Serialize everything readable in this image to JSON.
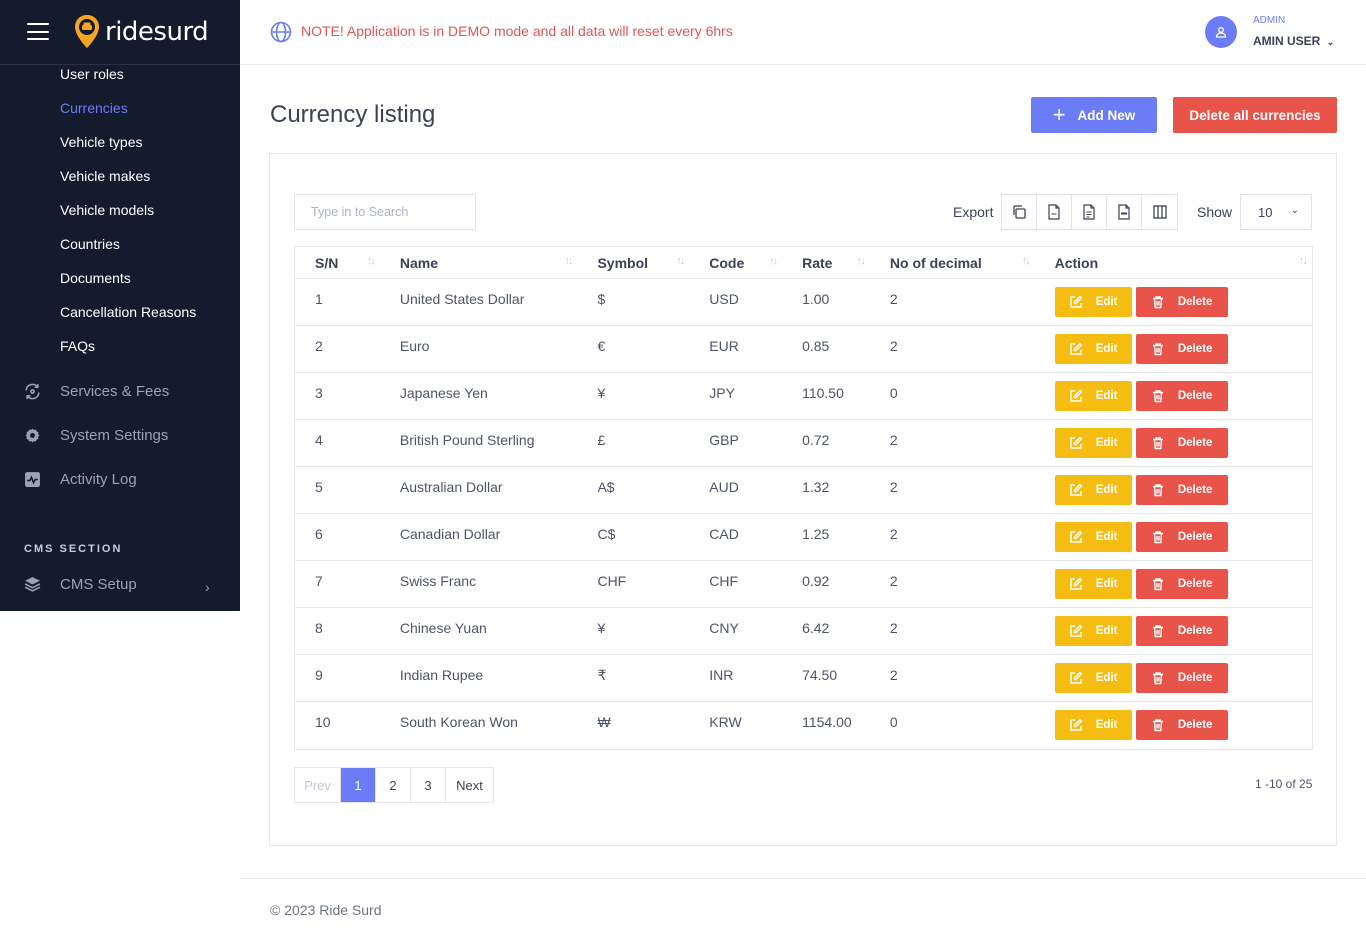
{
  "app": {
    "brand": "ridesurd"
  },
  "header": {
    "notice": "NOTE! Application is in DEMO mode and all data will reset every 6hrs",
    "user_role": "ADMIN",
    "user_name": "AMIN USER"
  },
  "sidebar": {
    "sub_items": [
      "User roles",
      "Currencies",
      "Vehicle types",
      "Vehicle makes",
      "Vehicle models",
      "Countries",
      "Documents",
      "Cancellation Reasons",
      "FAQs"
    ],
    "active_sub": "Currencies",
    "main_items": [
      "Services & Fees",
      "System Settings",
      "Activity Log"
    ],
    "section_title": "CMS SECTION",
    "cms_item": "CMS Setup"
  },
  "main": {
    "title": "Currency listing",
    "add_button": "Add New",
    "delete_all_button": "Delete all currencies",
    "search_placeholder": "Type in to Search",
    "export_label": "Export",
    "show_label": "Show",
    "show_value": "10",
    "columns": [
      "S/N",
      "Name",
      "Symbol",
      "Code",
      "Rate",
      "No of decimal",
      "Action"
    ],
    "rows": [
      [
        "1",
        "United States Dollar",
        "$",
        "USD",
        "1.00",
        "2"
      ],
      [
        "2",
        "Euro",
        "€",
        "EUR",
        "0.85",
        "2"
      ],
      [
        "3",
        "Japanese Yen",
        "¥",
        "JPY",
        "110.50",
        "0"
      ],
      [
        "4",
        "British Pound Sterling",
        "£",
        "GBP",
        "0.72",
        "2"
      ],
      [
        "5",
        "Australian Dollar",
        "A$",
        "AUD",
        "1.32",
        "2"
      ],
      [
        "6",
        "Canadian Dollar",
        "C$",
        "CAD",
        "1.25",
        "2"
      ],
      [
        "7",
        "Swiss Franc",
        "CHF",
        "CHF",
        "0.92",
        "2"
      ],
      [
        "8",
        "Chinese Yuan",
        "¥",
        "CNY",
        "6.42",
        "2"
      ],
      [
        "9",
        "Indian Rupee",
        "₹",
        "INR",
        "74.50",
        "2"
      ],
      [
        "10",
        "South Korean Won",
        "₩",
        "KRW",
        "1154.00",
        "0"
      ]
    ],
    "edit_label": "Edit",
    "delete_label": "Delete",
    "pagination": {
      "prev": "Prev",
      "pages": [
        "1",
        "2",
        "3"
      ],
      "current": "1",
      "next": "Next"
    },
    "range_text": "1 -10 of 25"
  },
  "footer": {
    "text": "© 2023 Ride Surd"
  },
  "colors": {
    "primary": "#6c7cf6",
    "danger": "#e8534a",
    "warning": "#f5bd12",
    "sidebar_bg": "#141b2d"
  }
}
